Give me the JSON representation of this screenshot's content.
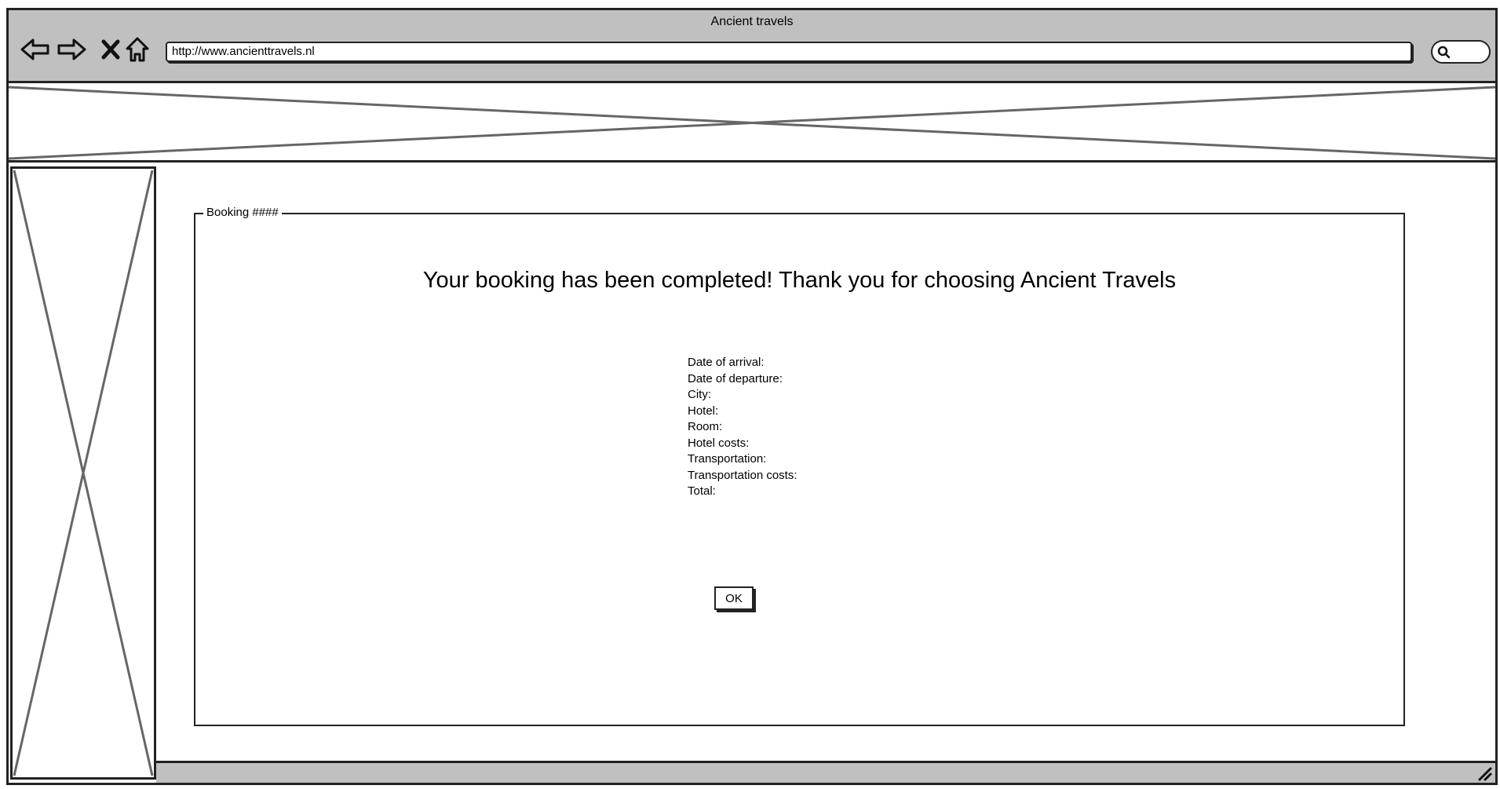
{
  "browser": {
    "window_title": "Ancient travels",
    "address_url": "http://www.ancienttravels.nl",
    "nav": {
      "back_icon": "arrow-left-icon",
      "forward_icon": "arrow-right-icon",
      "stop_icon": "close-x-icon",
      "home_icon": "home-icon",
      "search_icon": "search-icon"
    }
  },
  "placeholders": {
    "header": "image-placeholder",
    "sidebar": "image-placeholder"
  },
  "booking": {
    "legend": "Booking ####",
    "headline": "Your booking has been completed! Thank you for choosing Ancient Travels",
    "details": [
      "Date of arrival:",
      "Date of departure:",
      "City:",
      "Hotel:",
      "Room:",
      "Hotel costs:",
      "Transportation:",
      "Transportation costs:",
      "Total:"
    ],
    "ok_label": "OK"
  },
  "colors": {
    "chrome_gray": "#c0c0c0",
    "line": "#222222"
  }
}
